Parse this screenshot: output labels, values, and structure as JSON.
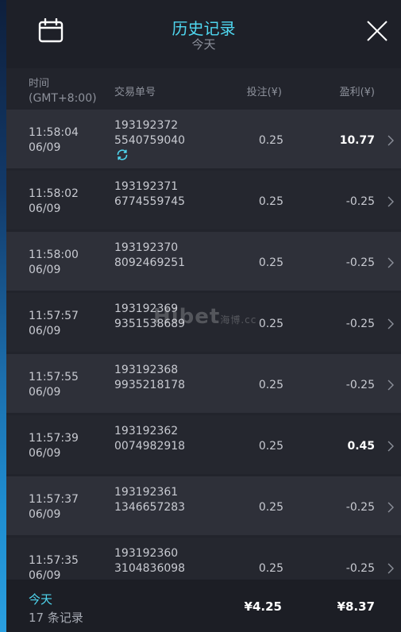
{
  "header": {
    "title": "历史记录",
    "subtitle": "今天"
  },
  "columns": {
    "time_label": "时间",
    "timezone": "(GMT+8:00)",
    "order_label": "交易单号",
    "stake_label": "投注(¥)",
    "profit_label": "盈利(¥)"
  },
  "rows": [
    {
      "time": "11:58:04",
      "date": "06/09",
      "id_line1": "193192372",
      "id_line2": "5540759040",
      "stake": "0.25",
      "profit": "10.77",
      "win": true,
      "pending": true
    },
    {
      "time": "11:58:02",
      "date": "06/09",
      "id_line1": "193192371",
      "id_line2": "6774559745",
      "stake": "0.25",
      "profit": "-0.25",
      "win": false
    },
    {
      "time": "11:58:00",
      "date": "06/09",
      "id_line1": "193192370",
      "id_line2": "8092469251",
      "stake": "0.25",
      "profit": "-0.25",
      "win": false
    },
    {
      "time": "11:57:57",
      "date": "06/09",
      "id_line1": "193192369",
      "id_line2": "9351538689",
      "stake": "0.25",
      "profit": "-0.25",
      "win": false
    },
    {
      "time": "11:57:55",
      "date": "06/09",
      "id_line1": "193192368",
      "id_line2": "9935218178",
      "stake": "0.25",
      "profit": "-0.25",
      "win": false
    },
    {
      "time": "11:57:39",
      "date": "06/09",
      "id_line1": "193192362",
      "id_line2": "0074982918",
      "stake": "0.25",
      "profit": "0.45",
      "win": true
    },
    {
      "time": "11:57:37",
      "date": "06/09",
      "id_line1": "193192361",
      "id_line2": "1346657283",
      "stake": "0.25",
      "profit": "-0.25",
      "win": false
    },
    {
      "time": "11:57:35",
      "date": "06/09",
      "id_line1": "193192360",
      "id_line2": "3104836098",
      "stake": "0.25",
      "profit": "-0.25",
      "win": false
    }
  ],
  "watermark": {
    "main": "Hibet",
    "sub": "海博.cc"
  },
  "footer": {
    "today": "今天",
    "count": "17 条记录",
    "total_stake": "¥4.25",
    "total_profit": "¥8.37"
  },
  "colors": {
    "accent": "#4fd7f0",
    "row_a": "#2e3039",
    "row_b": "#25272f"
  },
  "icons": {
    "calendar": "calendar-icon",
    "close": "close-icon",
    "chevron": "chevron-right-icon",
    "pending": "refresh-icon"
  }
}
